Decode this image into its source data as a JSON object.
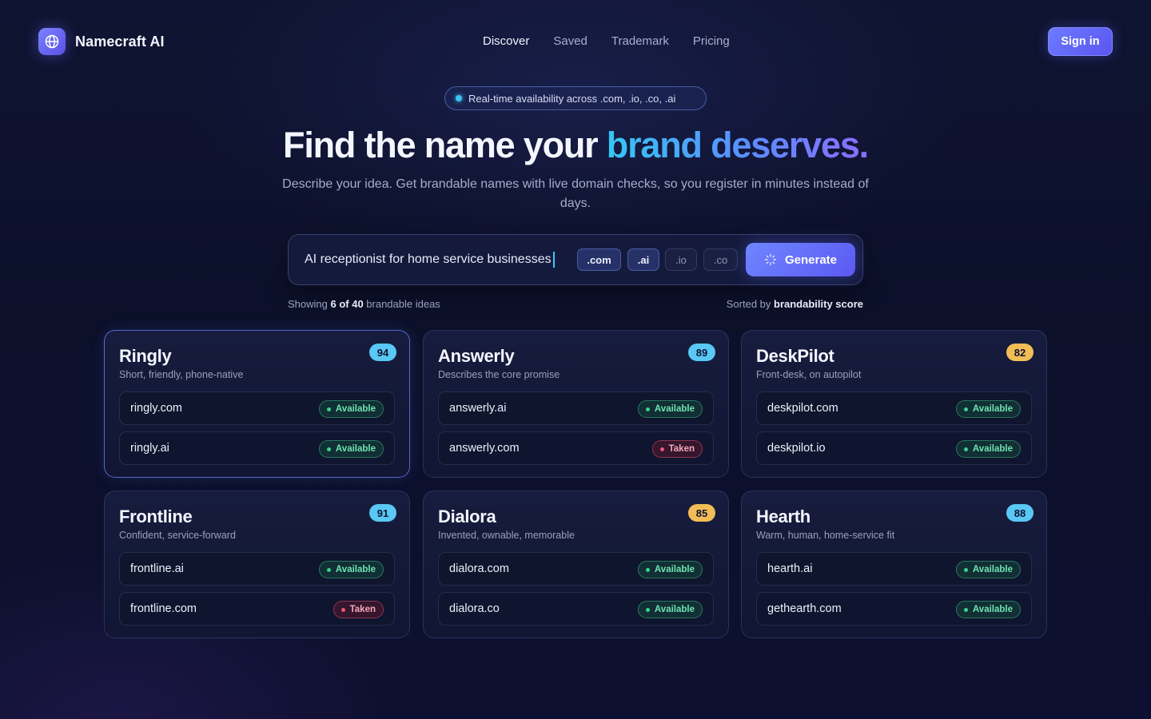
{
  "header": {
    "brand": "Namecraft AI",
    "nav": [
      "Discover",
      "Saved",
      "Trademark",
      "Pricing"
    ],
    "active_nav": "Discover",
    "signin_label": "Sign in"
  },
  "hero": {
    "pill_text": "Real-time availability across .com, .io, .co, .ai",
    "title_main": "Find the name your ",
    "title_accent": "brand deserves.",
    "subtitle": "Describe your idea. Get brandable names with live domain checks, so you register in minutes instead of days."
  },
  "search": {
    "query": "AI receptionist for home service businesses",
    "tlds": [
      {
        "label": ".com",
        "selected": true
      },
      {
        "label": ".ai",
        "selected": true
      },
      {
        "label": ".io",
        "selected": false
      },
      {
        "label": ".co",
        "selected": false
      }
    ],
    "generate_label": "Generate"
  },
  "results_meta": {
    "showing_prefix": "Showing ",
    "showing_count": "6 of 40",
    "showing_suffix": " brandable ideas",
    "sorted_prefix": "Sorted by ",
    "sorted_by": "brandability score"
  },
  "cards": [
    {
      "name": "Ringly",
      "desc": "Short, friendly, phone-native",
      "score": "94",
      "score_color": "blue",
      "domains": [
        {
          "domain": "ringly.com",
          "status": "Available"
        },
        {
          "domain": "ringly.ai",
          "status": "Available"
        }
      ]
    },
    {
      "name": "Answerly",
      "desc": "Describes the core promise",
      "score": "89",
      "score_color": "blue",
      "domains": [
        {
          "domain": "answerly.ai",
          "status": "Available"
        },
        {
          "domain": "answerly.com",
          "status": "Taken"
        }
      ]
    },
    {
      "name": "DeskPilot",
      "desc": "Front-desk, on autopilot",
      "score": "82",
      "score_color": "amber",
      "domains": [
        {
          "domain": "deskpilot.com",
          "status": "Available"
        },
        {
          "domain": "deskpilot.io",
          "status": "Available"
        }
      ]
    },
    {
      "name": "Frontline",
      "desc": "Confident, service-forward",
      "score": "91",
      "score_color": "blue",
      "domains": [
        {
          "domain": "frontline.ai",
          "status": "Available"
        },
        {
          "domain": "frontline.com",
          "status": "Taken"
        }
      ]
    },
    {
      "name": "Dialora",
      "desc": "Invented, ownable, memorable",
      "score": "85",
      "score_color": "amber",
      "domains": [
        {
          "domain": "dialora.com",
          "status": "Available"
        },
        {
          "domain": "dialora.co",
          "status": "Available"
        }
      ]
    },
    {
      "name": "Hearth",
      "desc": "Warm, human, home-service fit",
      "score": "88",
      "score_color": "blue",
      "domains": [
        {
          "domain": "hearth.ai",
          "status": "Available"
        },
        {
          "domain": "gethearth.com",
          "status": "Available"
        }
      ]
    }
  ],
  "selected_card": "Ringly",
  "colors": {
    "accent": "#5c6cff",
    "accent_cyan": "#35c6f4",
    "available": "#35d48f",
    "taken": "#f0587a",
    "score_blue": "#59c8f4",
    "score_amber": "#f2bd55"
  }
}
